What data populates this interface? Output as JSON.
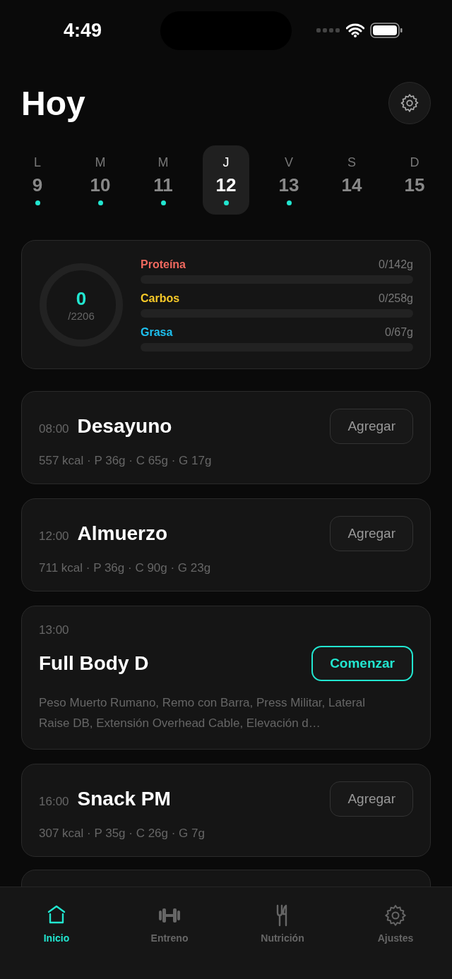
{
  "status_bar": {
    "time": "4:49"
  },
  "header": {
    "title": "Hoy"
  },
  "days": [
    {
      "letter": "L",
      "number": "9",
      "dot": true,
      "selected": false
    },
    {
      "letter": "M",
      "number": "10",
      "dot": true,
      "selected": false
    },
    {
      "letter": "M",
      "number": "11",
      "dot": true,
      "selected": false
    },
    {
      "letter": "J",
      "number": "12",
      "dot": true,
      "selected": true
    },
    {
      "letter": "V",
      "number": "13",
      "dot": true,
      "selected": false
    },
    {
      "letter": "S",
      "number": "14",
      "dot": false,
      "selected": false
    },
    {
      "letter": "D",
      "number": "15",
      "dot": false,
      "selected": false
    }
  ],
  "summary": {
    "calories": "0",
    "calorie_goal": "/2206",
    "macros": [
      {
        "name": "Proteína",
        "reading": "0/142g",
        "color": "#f0695f"
      },
      {
        "name": "Carbos",
        "reading": "0/258g",
        "color": "#f7c928"
      },
      {
        "name": "Grasa",
        "reading": "0/67g",
        "color": "#1ec0ef"
      }
    ]
  },
  "entries": [
    {
      "kind": "meal",
      "time": "08:00",
      "name": "Desayuno",
      "details": "557 kcal · P 36g · C 65g · G 17g",
      "button": "Agregar"
    },
    {
      "kind": "meal",
      "time": "12:00",
      "name": "Almuerzo",
      "details": "711 kcal · P 36g · C 90g · G 23g",
      "button": "Agregar"
    },
    {
      "kind": "workout",
      "time": "13:00",
      "name": "Full Body D",
      "details": "Peso Muerto Rumano, Remo con Barra, Press Militar, Lateral Raise DB, Extensión Overhead Cable, Elevación d…",
      "button": "Comenzar"
    },
    {
      "kind": "meal",
      "time": "16:00",
      "name": "Snack PM",
      "details": "307 kcal · P 35g · C 26g · G 7g",
      "button": "Agregar"
    },
    {
      "kind": "hidden"
    }
  ],
  "tab_bar": [
    {
      "label": "Inicio",
      "selected": true
    },
    {
      "label": "Entreno",
      "selected": false
    },
    {
      "label": "Nutrición",
      "selected": false
    },
    {
      "label": "Ajustes",
      "selected": false
    }
  ]
}
